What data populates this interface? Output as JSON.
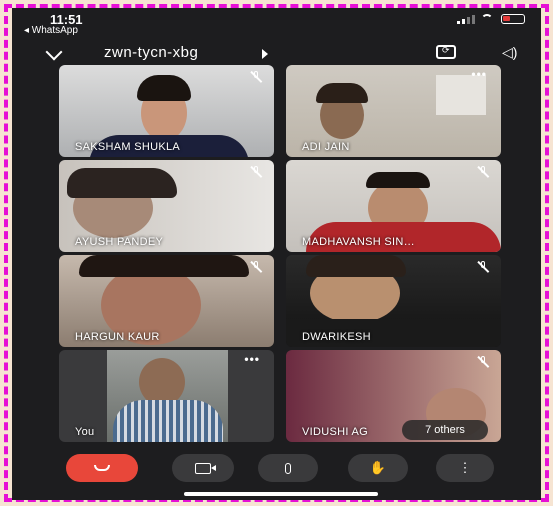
{
  "status": {
    "time": "11:51",
    "back_app": "◂ WhatsApp"
  },
  "meeting": {
    "code": "zwn-tycn-xbg",
    "collapse_icon": "chevron-down-icon",
    "switch_camera_icon": "camera-switch-icon",
    "audio_icon": "speaker-icon"
  },
  "participants": [
    {
      "name": "SAKSHAM SHUKLA",
      "muted": true,
      "more": false
    },
    {
      "name": "ADI JAIN",
      "muted": false,
      "more": true
    },
    {
      "name": "AYUSH PANDEY",
      "muted": true,
      "more": false
    },
    {
      "name": "MADHAVANSH SIN…",
      "muted": true,
      "more": false
    },
    {
      "name": "HARGUN KAUR",
      "muted": true,
      "more": false
    },
    {
      "name": "DWARIKESH",
      "muted": true,
      "more": false
    },
    {
      "name": "You",
      "muted": false,
      "more": true
    },
    {
      "name": "VIDUSHI AG",
      "muted": true,
      "more": false
    }
  ],
  "others_label": "7 others",
  "controls": {
    "hangup_icon": "hang-up-icon",
    "camera_icon": "video-camera-icon",
    "mic_icon": "microphone-icon",
    "hand_icon": "raise-hand-icon",
    "more_icon": "more-options-icon",
    "accent": "#e8473a"
  }
}
